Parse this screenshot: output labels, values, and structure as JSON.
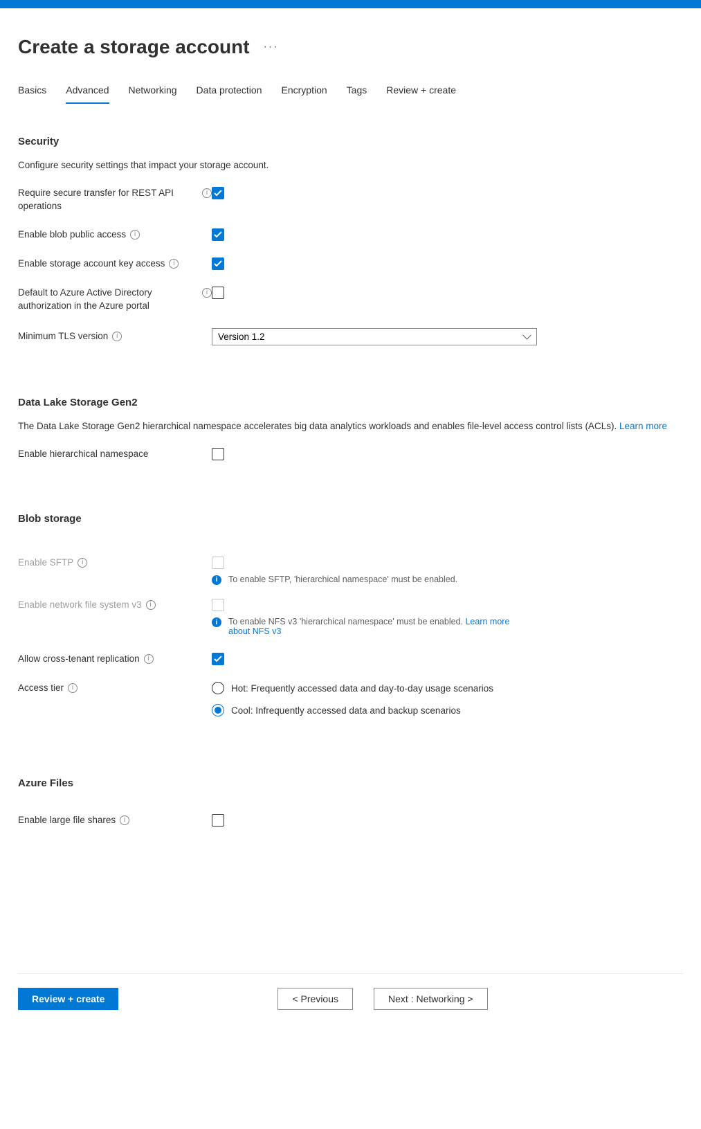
{
  "header": {
    "title": "Create a storage account"
  },
  "tabs": [
    "Basics",
    "Advanced",
    "Networking",
    "Data protection",
    "Encryption",
    "Tags",
    "Review + create"
  ],
  "active_tab_index": 1,
  "security": {
    "heading": "Security",
    "desc": "Configure security settings that impact your storage account.",
    "secure_transfer_label": "Require secure transfer for REST API operations",
    "blob_public_label": "Enable blob public access",
    "key_access_label": "Enable storage account key access",
    "aad_label": "Default to Azure Active Directory authorization in the Azure portal",
    "tls_label": "Minimum TLS version",
    "tls_value": "Version 1.2"
  },
  "datalake": {
    "heading": "Data Lake Storage Gen2",
    "desc": "The Data Lake Storage Gen2 hierarchical namespace accelerates big data analytics workloads and enables file-level access control lists (ACLs). ",
    "learn_more": "Learn more",
    "hns_label": "Enable hierarchical namespace"
  },
  "blob": {
    "heading": "Blob storage",
    "sftp_label": "Enable SFTP",
    "sftp_note": "To enable SFTP, 'hierarchical namespace' must be enabled.",
    "nfs_label": "Enable network file system v3",
    "nfs_note": "To enable NFS v3 'hierarchical namespace' must be enabled. ",
    "nfs_learn": "Learn more about NFS v3",
    "cross_tenant_label": "Allow cross-tenant replication",
    "access_tier_label": "Access tier",
    "hot_label": "Hot: Frequently accessed data and day-to-day usage scenarios",
    "cool_label": "Cool: Infrequently accessed data and backup scenarios"
  },
  "azurefiles": {
    "heading": "Azure Files",
    "large_shares_label": "Enable large file shares"
  },
  "footer": {
    "review": "Review + create",
    "prev": "< Previous",
    "next": "Next : Networking >"
  }
}
